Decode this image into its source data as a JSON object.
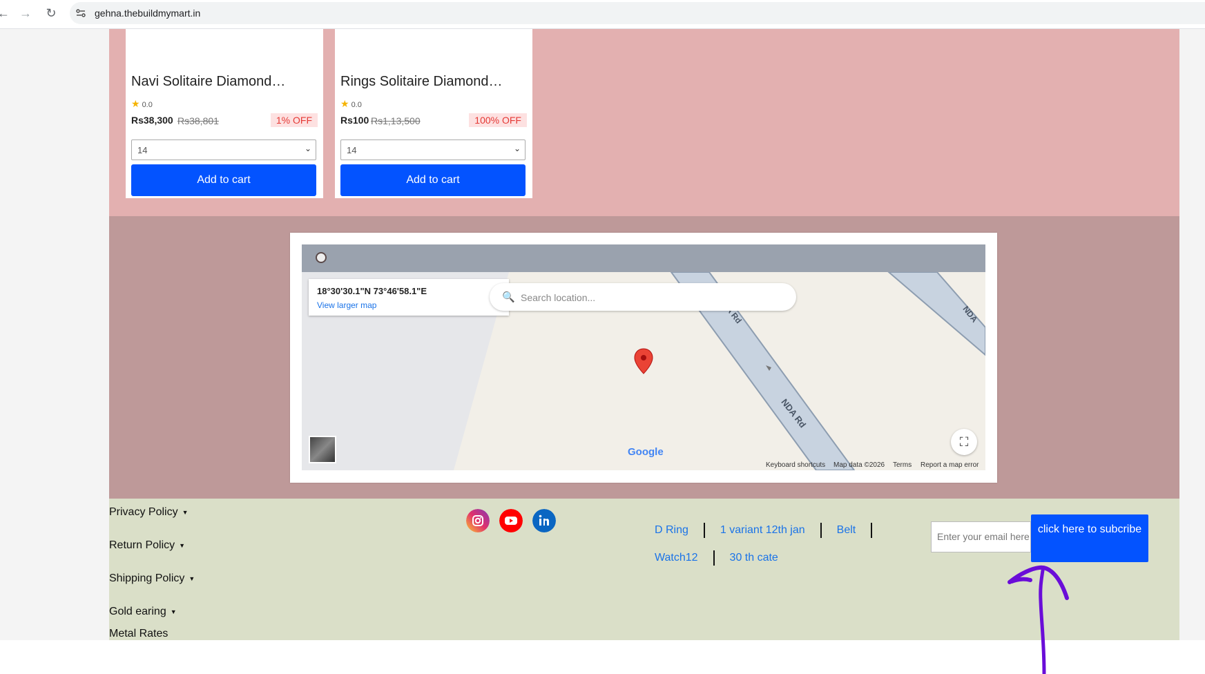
{
  "browser": {
    "url": "gehna.thebuildmymart.in"
  },
  "products": [
    {
      "title": "Navi Solitaire Diamond…",
      "rating": "0.0",
      "price": "Rs38,300",
      "mrp": "Rs38,801",
      "discount": "1% OFF",
      "size_selected": "14",
      "cart_label": "Add to cart"
    },
    {
      "title": "Rings Solitaire Diamond…",
      "rating": "0.0",
      "price": "Rs100",
      "mrp": "Rs1,13,500",
      "discount": "100% OFF",
      "size_selected": "14",
      "cart_label": "Add to cart"
    }
  ],
  "map": {
    "coordinates": "18°30'30.1\"N 73°46'58.1\"E",
    "larger_map": "View larger map",
    "search_placeholder": "Search location...",
    "road_labels": [
      "A Rd",
      "NDA Rd",
      "NDA"
    ],
    "logo": "Google",
    "attribution": [
      "Keyboard shortcuts",
      "Map data ©2026",
      "Terms",
      "Report a map error"
    ]
  },
  "footer": {
    "policies": [
      "Privacy Policy",
      "Return Policy",
      "Shipping Policy",
      "Gold earing"
    ],
    "metal_rates": "Metal Rates",
    "social": [
      "instagram-icon",
      "youtube-icon",
      "linkedin-icon"
    ],
    "links_row1": [
      "D Ring",
      "1 variant 12th jan",
      "Belt"
    ],
    "links_row2": [
      "Watch12",
      "30 th cate"
    ],
    "email_placeholder": "Enter your email here",
    "subscribe_label": "click here to subcribe"
  },
  "colors": {
    "products_bg": "#e3b0b0",
    "map_bg": "#be9999",
    "footer_bg": "#dadfc8",
    "button_blue": "#0353ff",
    "annotation_purple": "#6a0dd8"
  }
}
